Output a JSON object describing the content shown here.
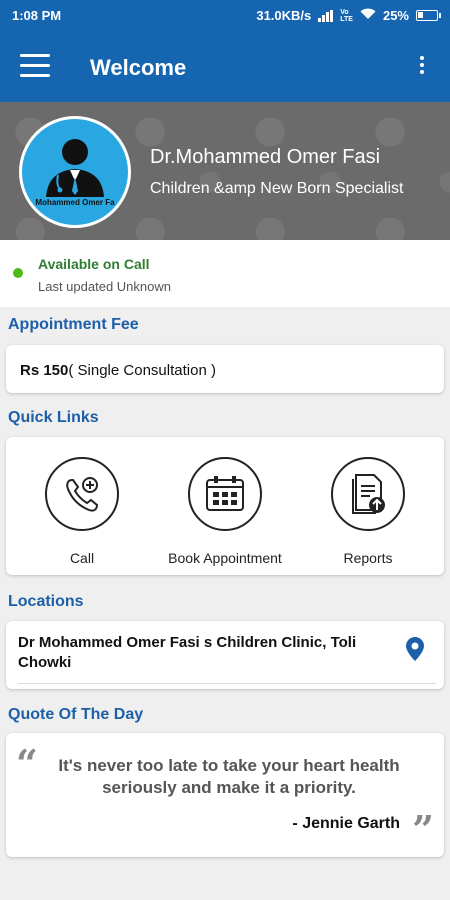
{
  "status_bar": {
    "time": "1:08 PM",
    "speed": "31.0KB/s",
    "battery": "25%",
    "icons": [
      "clock-icon",
      "signal-icon",
      "volte-icon",
      "wifi-icon",
      "battery-charging-icon"
    ]
  },
  "app_bar": {
    "title": "Welcome",
    "menu_icon": "hamburger-icon",
    "overflow_icon": "more-vert-icon"
  },
  "profile": {
    "avatar_text": "Mohammed Omer Fa",
    "name": "Dr.Mohammed Omer Fasi",
    "specialty": "Children &amp New Born Specialist"
  },
  "availability": {
    "status": "Available on Call",
    "updated": "Last updated Unknown",
    "status_color": "#4cbb17"
  },
  "fee": {
    "heading": "Appointment Fee",
    "amount": "Rs 150",
    "detail": "( Single Consultation )"
  },
  "quick_links": {
    "heading": "Quick Links",
    "items": [
      {
        "label": "Call",
        "icon": "phone-add-icon"
      },
      {
        "label": "Book Appointment",
        "icon": "calendar-icon"
      },
      {
        "label": "Reports",
        "icon": "report-upload-icon"
      }
    ]
  },
  "locations": {
    "heading": "Locations",
    "items": [
      {
        "name": "Dr Mohammed Omer Fasi s Children Clinic, Toli Chowki",
        "icon": "map-pin-icon"
      }
    ]
  },
  "quote": {
    "heading": "Quote Of The Day",
    "text": "It's never too late to take your heart health seriously and make it a priority.",
    "author": "- Jennie Garth",
    "open_mark": "“",
    "close_mark": "”"
  },
  "colors": {
    "primary": "#1565b0",
    "section_title": "#1d5fa8",
    "available": "#2e7d32",
    "pin": "#1d5fa8"
  }
}
